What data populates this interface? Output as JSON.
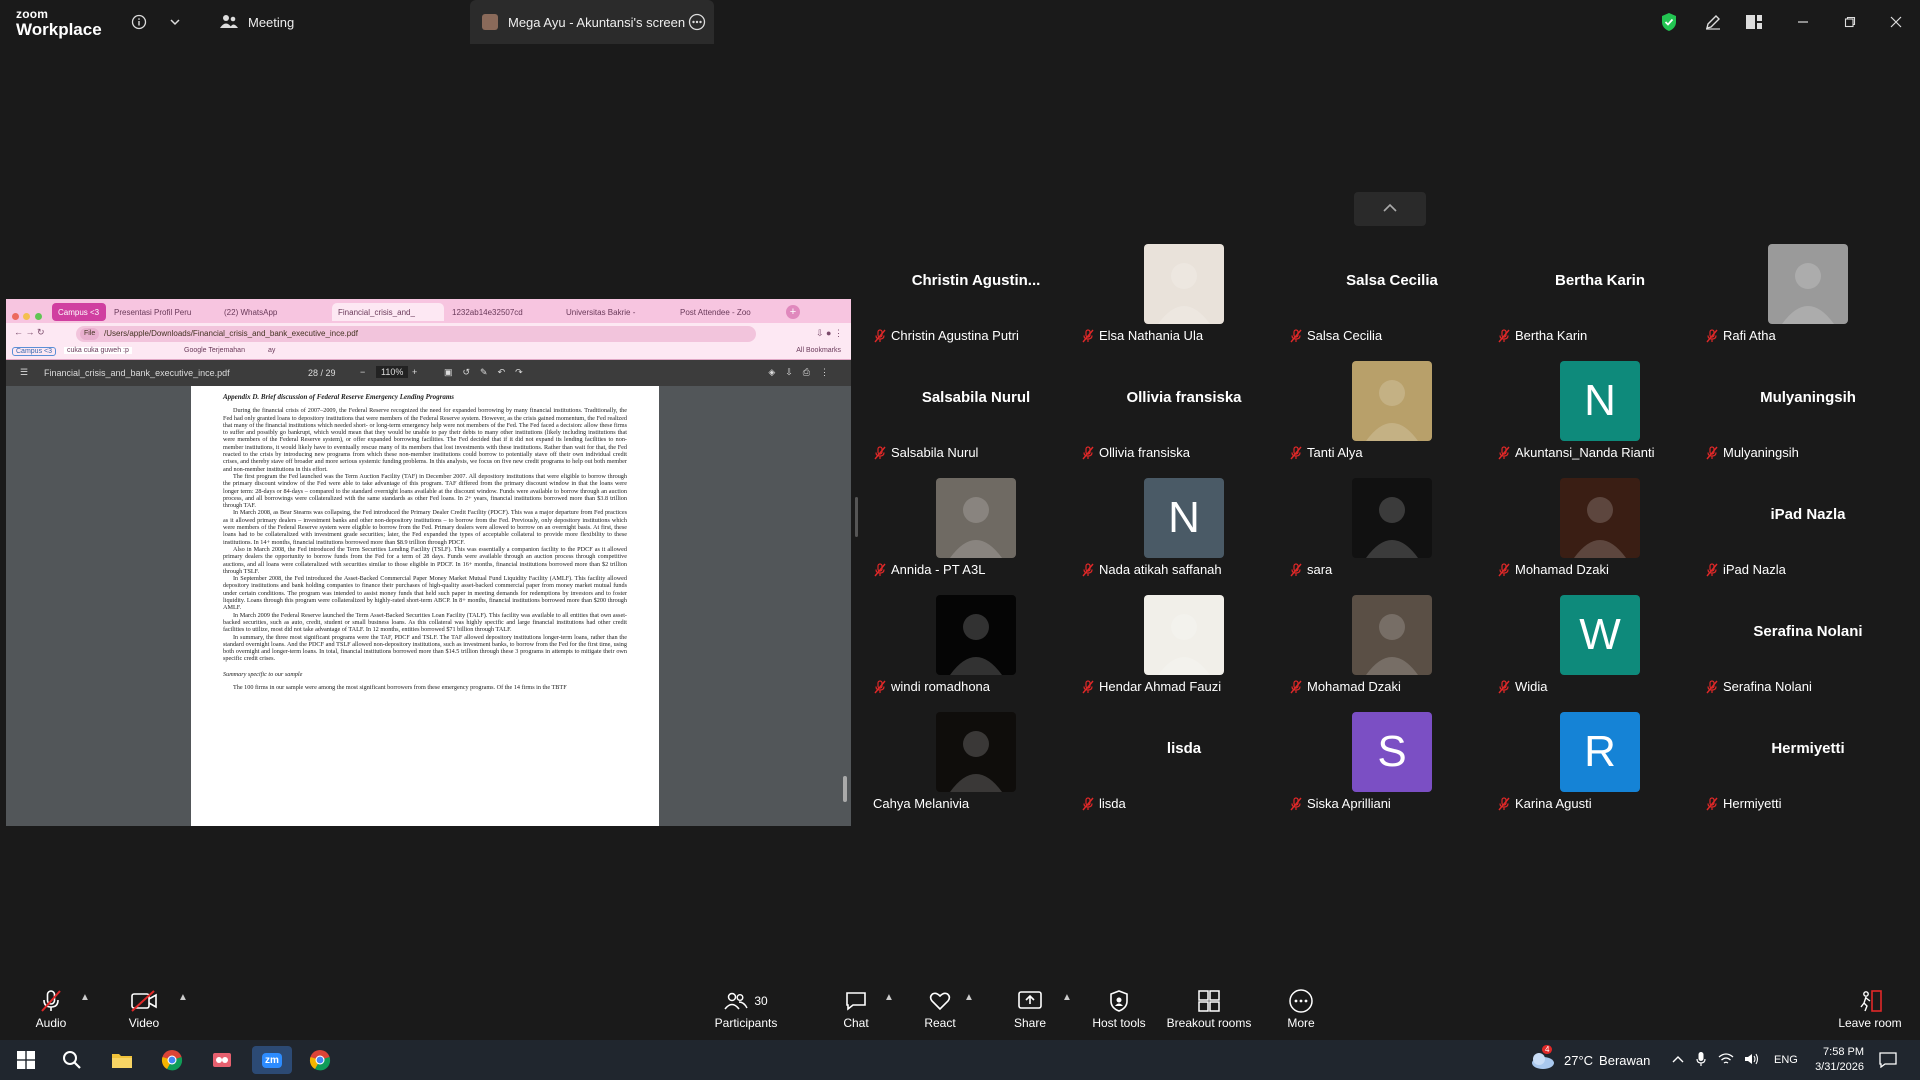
{
  "window": {
    "logo_line1": "zoom",
    "logo_line2": "Workplace",
    "tabs": [
      {
        "label": "Meeting"
      },
      {
        "label": "Mega Ayu - Akuntansi's screen"
      }
    ]
  },
  "shared_screen": {
    "browser_tabs": [
      "Campus <3",
      "Presentasi Profil Peru",
      "(22) WhatsApp",
      "Financial_crisis_and_",
      "1232ab14e32507cd",
      "Universitas Bakrie -",
      "Post Attendee - Zoo"
    ],
    "address": "/Users/apple/Downloads/Financial_crisis_and_bank_executive_ince.pdf",
    "address_prefix": "File",
    "bookmarks": [
      "Campus <3",
      "cuka cuka guweh :p",
      "Google Terjemahan",
      "ay",
      "All Bookmarks"
    ],
    "pdf_filename": "Financial_crisis_and_bank_executive_ince.pdf",
    "page_indicator": "28 / 29",
    "zoom": "110%",
    "heading": "Appendix D. Brief discussion of Federal Reserve Emergency Lending Programs",
    "paragraphs": [
      "During the financial crisis of 2007–2009, the Federal Reserve recognized the need for expanded borrowing by many financial institutions. Traditionally, the Fed had only granted loans to depository institutions that were members of the Federal Reserve system. However, as the crisis gained momentum, the Fed realized that many of the financial institutions which needed short- or long-term emergency help were not members of the Fed. The Fed faced a decision: allow these firms to suffer and possibly go bankrupt, which would mean that they would be unable to pay their debts to many other institutions (likely including institutions that were members of the Federal Reserve system), or offer expanded borrowing facilities. The Fed decided that if it did not expand its lending facilities to non-member institutions, it would likely have to eventually rescue many of its members that lost investments with these institutions. Rather than wait for that, the Fed reacted to the crisis by introducing new programs from which these non-member institutions could borrow to potentially stave off their own individual credit crises, and thereby stave off broader and more serious systemic funding problems. In this analysis, we focus on five new credit programs to help out both member and non-member institutions in this effort.",
      "The first program the Fed launched was the Term Auction Facility (TAF) in December 2007. All depository institutions that were eligible to borrow through the primary discount window of the Fed were able to take advantage of this program. TAF differed from the primary discount window in that the loans were longer term: 28-days or 84-days – compared to the standard overnight loans available at the discount window. Funds were available to borrow through an auction process, and all borrowings were collateralized with the same standards as other Fed loans. In 2+ years, financial institutions borrowed more than $3.8 trillion through TAF.",
      "In March 2008, as Bear Stearns was collapsing, the Fed introduced the Primary Dealer Credit Facility (PDCF). This was a major departure from Fed practices as it allowed primary dealers – investment banks and other non-depository institutions – to borrow from the Fed. Previously, only depository institutions which were members of the Federal Reserve system were eligible to borrow from the Fed. Primary dealers were allowed to borrow on an overnight basis. At first, these loans had to be collateralized with investment grade securities; later, the Fed expanded the types of acceptable collateral to provide more flexibility to these institutions. In 14+ months, financial institutions borrowed more than $8.9 trillion through PDCF.",
      "Also in March 2008, the Fed introduced the Term Securities Lending Facility (TSLF). This was essentially a companion facility to the PDCF as it allowed primary dealers the opportunity to borrow funds from the Fed for a term of 28 days. Funds were available through an auction process through competitive auctions, and all loans were collateralized with securities similar to those eligible in PDCF. In 16+ months, financial institutions borrowed more than $2 trillion through TSLF.",
      "In September 2008, the Fed introduced the Asset-Backed Commercial Paper Money Market Mutual Fund Liquidity Facility (AMLF). This facility allowed depository institutions and bank holding companies to finance their purchases of high-quality asset-backed commercial paper from money market mutual funds under certain conditions. The program was intended to assist money funds that held such paper in meeting demands for redemptions by investors and to foster liquidity. Loans through this program were collateralized by highly-rated short-term ABCP. In 8+ months, financial institutions borrowed more than $200 through AMLF.",
      "In March 2009 the Federal Reserve launched the Term Asset-Backed Securities Loan Facility (TALF). This facility was available to all entities that own asset-backed securities, such as auto, credit, student or small business loans. As this collateral was highly specific and large financial institutions had other credit facilities to utilize, most did not take advantage of TALF. In 12 months, entities borrowed $71 billion through TALF.",
      "In summary, the three most significant programs were the TAF, PDCF and TSLF. The TAF allowed depository institutions longer-term loans, rather than the standard overnight loans. And the PDCF and TSLF allowed non-depository institutions, such as investment banks, to borrow from the Fed for the first time, using both overnight and longer-term loans. In total, financial institutions borrowed more than $14.5 trillion through these 3 programs in attempts to mitigate their own specific credit crises."
    ],
    "subheading": "Summary specific to our sample",
    "last_paragraph": "The 100 firms in our sample were among the most significant borrowers from these emergency programs. Of the 14 firms in the TBTF"
  },
  "participants": [
    {
      "display": "Christin  Agustin...",
      "name": "Christin Agustina Putri",
      "type": "text"
    },
    {
      "display": "",
      "name": "Elsa Nathania Ula",
      "type": "photo",
      "color": "#e9e2da"
    },
    {
      "display": "Salsa Cecilia",
      "name": "Salsa Cecilia",
      "type": "text"
    },
    {
      "display": "Bertha Karin",
      "name": "Bertha Karin",
      "type": "text"
    },
    {
      "display": "",
      "name": "Rafi Atha",
      "type": "photo",
      "color": "#9a9a9a"
    },
    {
      "display": "Salsabila Nurul",
      "name": "Salsabila Nurul",
      "type": "text"
    },
    {
      "display": "Ollivia fransiska",
      "name": "Ollivia fransiska",
      "type": "text"
    },
    {
      "display": "",
      "name": "Tanti Alya",
      "type": "photo",
      "color": "#b8a06a"
    },
    {
      "display": "N",
      "name": "Akuntansi_Nanda Rianti",
      "type": "letter",
      "color": "#0e8a7b"
    },
    {
      "display": "Mulyaningsih",
      "name": "Mulyaningsih",
      "type": "text"
    },
    {
      "display": "",
      "name": "Annida - PT A3L",
      "type": "photo",
      "color": "#6f6a63"
    },
    {
      "display": "N",
      "name": "Nada atikah saffanah",
      "type": "letter",
      "color": "#4a5a66"
    },
    {
      "display": "",
      "name": "sara",
      "type": "photo",
      "color": "#111111"
    },
    {
      "display": "",
      "name": "Mohamad Dzaki",
      "type": "photo",
      "color": "#3a1e14"
    },
    {
      "display": "iPad Nazla",
      "name": "iPad Nazla",
      "type": "text"
    },
    {
      "display": "",
      "name": "windi romadhona",
      "type": "photo",
      "color": "#050505"
    },
    {
      "display": "",
      "name": "Hendar Ahmad Fauzi",
      "type": "photo",
      "color": "#f1efe9"
    },
    {
      "display": "",
      "name": "Mohamad Dzaki",
      "type": "photo",
      "color": "#5a4f45"
    },
    {
      "display": "W",
      "name": "Widia",
      "type": "letter",
      "color": "#0e8a7b"
    },
    {
      "display": "Serafina Nolani",
      "name": "Serafina Nolani",
      "type": "text"
    },
    {
      "display": "",
      "name": "Cahya Melanivia",
      "type": "photo",
      "color": "#0f0d0b"
    },
    {
      "display": "lisda",
      "name": "lisda",
      "type": "text"
    },
    {
      "display": "S",
      "name": "Siska Aprilliani",
      "type": "letter",
      "color": "#7b4fc4"
    },
    {
      "display": "R",
      "name": "Karina Agusti",
      "type": "letter",
      "color": "#1583d6"
    },
    {
      "display": "Hermiyetti",
      "name": "Hermiyetti",
      "type": "text"
    }
  ],
  "controls": {
    "audio": "Audio",
    "video": "Video",
    "participants": "Participants",
    "participants_count": "30",
    "chat": "Chat",
    "react": "React",
    "share": "Share",
    "host_tools": "Host tools",
    "breakout": "Breakout rooms",
    "more": "More",
    "leave": "Leave room"
  },
  "taskbar": {
    "weather_temp": "27°C",
    "weather_text": "Berawan",
    "weather_badge": "4",
    "lang": "ENG",
    "time": "7:58 PM",
    "date": "3/31/2026"
  },
  "colors": {
    "mute_red": "#e02828",
    "shield_green": "#23c552",
    "leave_red": "#e02828"
  }
}
